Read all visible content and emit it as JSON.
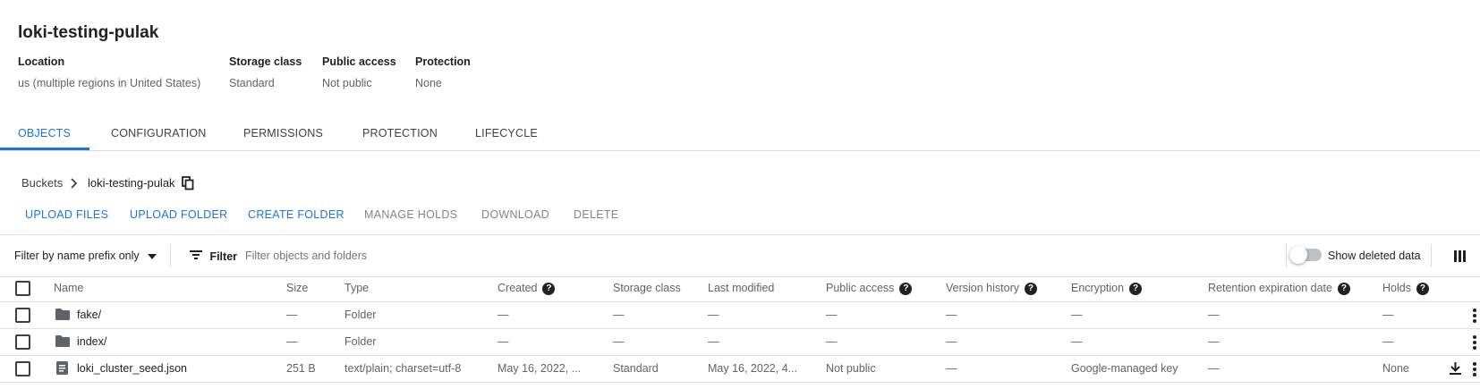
{
  "bucket": {
    "name": "loki-testing-pulak",
    "location_label": "Location",
    "location_value": "us (multiple regions in United States)",
    "storage_class_label": "Storage class",
    "storage_class_value": "Standard",
    "public_access_label": "Public access",
    "public_access_value": "Not public",
    "protection_label": "Protection",
    "protection_value": "None"
  },
  "tabs": [
    "OBJECTS",
    "CONFIGURATION",
    "PERMISSIONS",
    "PROTECTION",
    "LIFECYCLE"
  ],
  "active_tab": "OBJECTS",
  "breadcrumb": {
    "root": "Buckets",
    "current": "loki-testing-pulak"
  },
  "actions": {
    "upload_files": "UPLOAD FILES",
    "upload_folder": "UPLOAD FOLDER",
    "create_folder": "CREATE FOLDER",
    "manage_holds": "MANAGE HOLDS",
    "download": "DOWNLOAD",
    "delete": "DELETE"
  },
  "filter": {
    "mode": "Filter by name prefix only",
    "label": "Filter",
    "placeholder": "Filter objects and folders",
    "show_deleted": "Show deleted data",
    "show_deleted_on": false
  },
  "table": {
    "columns": [
      "Name",
      "Size",
      "Type",
      "Created",
      "Storage class",
      "Last modified",
      "Public access",
      "Version history",
      "Encryption",
      "Retention expiration date",
      "Holds"
    ],
    "rows": [
      [
        "fake/",
        "—",
        "Folder",
        "—",
        "—",
        "—",
        "—",
        "—",
        "—",
        "—",
        "—"
      ],
      [
        "index/",
        "—",
        "Folder",
        "—",
        "—",
        "—",
        "—",
        "—",
        "—",
        "—",
        "—"
      ],
      [
        "loki_cluster_seed.json",
        "251 B",
        "text/plain; charset=utf-8",
        "May 16, 2022, ...",
        "Standard",
        "May 16, 2022, 4...",
        "Not public",
        "—",
        "Google-managed key",
        "—",
        "None"
      ]
    ],
    "row_icons": [
      "folder-icon",
      "folder-icon",
      "file-icon"
    ]
  },
  "colors": {
    "accent": "#1a73e8",
    "text": "#202124",
    "muted": "#5f6368",
    "border": "#e0e0e0"
  }
}
